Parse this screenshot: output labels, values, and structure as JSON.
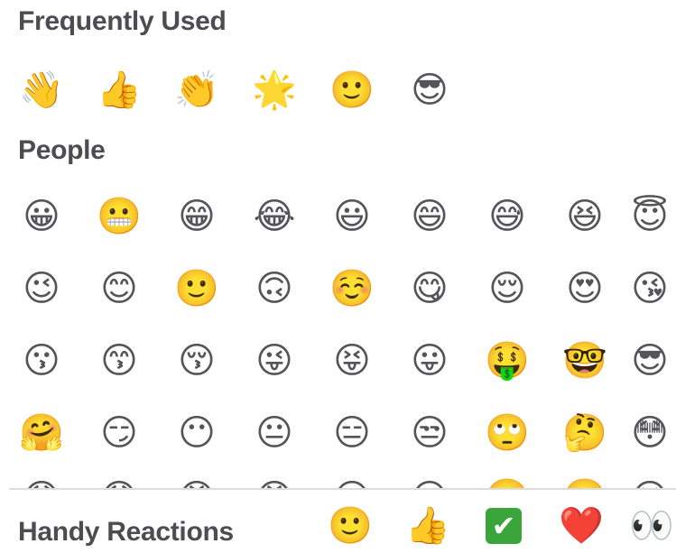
{
  "sections": {
    "frequent": {
      "title": "Frequently Used",
      "emojis": [
        "👋",
        "👍",
        "👏",
        "🌟",
        "🙂",
        "😎"
      ]
    },
    "people": {
      "title": "People",
      "rows": [
        [
          "😀",
          "😬",
          "😁",
          "😂",
          "😃",
          "😄",
          "😅",
          "😆",
          "😇"
        ],
        [
          "😉",
          "😊",
          "🙂",
          "🙃",
          "☺️",
          "😋",
          "😌",
          "😍",
          "😘"
        ],
        [
          "😗",
          "😙",
          "😚",
          "😜",
          "😝",
          "😛",
          "🤑",
          "🤓",
          "😎"
        ],
        [
          "🤗",
          "😏",
          "😶",
          "😐",
          "😑",
          "😒",
          "🙄",
          "🤔",
          "😳"
        ],
        [
          "😞",
          "😟",
          "😠",
          "😡",
          "😔",
          "😕",
          "🙁",
          "☹️",
          "😣"
        ]
      ]
    }
  },
  "footer": {
    "label": "Handy Reactions",
    "reactions": [
      "🙂",
      "👍",
      "✔",
      "❤️",
      "👀"
    ]
  }
}
